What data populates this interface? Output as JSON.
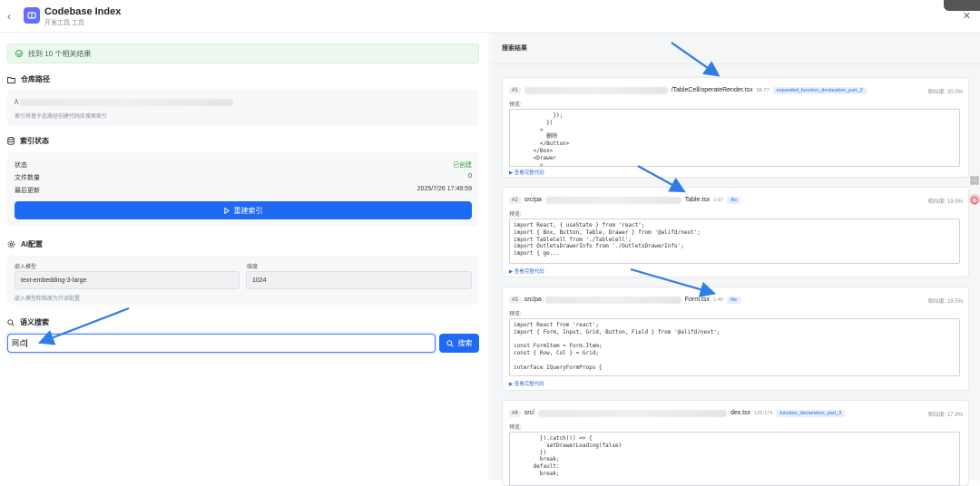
{
  "header": {
    "back_icon": "chevron-left-icon",
    "title": "Codebase Index",
    "subtitle": "开发工具 工具",
    "close_icon": "close-icon"
  },
  "left": {
    "notice": "找到 10 个相关结果",
    "repo": {
      "title": "仓库路径",
      "path_prefix": "/\\",
      "hint": "索引将基于此路径创建代码库搜索索引"
    },
    "index": {
      "title": "索引状态",
      "rows": [
        {
          "label": "状态",
          "value": "已创建"
        },
        {
          "label": "文件数量",
          "value": "0"
        },
        {
          "label": "最后更新",
          "value": "2025/7/26 17:49:59"
        }
      ],
      "rebuild_label": "重建索引"
    },
    "ai": {
      "title": "AI配置",
      "model_label": "嵌入模型",
      "model_value": "text-embedding-3-large",
      "dim_label": "维度",
      "dim_value": "1024",
      "hint": "嵌入模型和维度为只读配置"
    },
    "search": {
      "title": "语义搜索",
      "value": "网点",
      "button_label": "搜索"
    }
  },
  "right": {
    "title": "搜索结果",
    "preview_label": "预览:",
    "view_more": "▶ 查看完整代码",
    "results": [
      {
        "num": "#1",
        "path_start": "",
        "path_end": "/TableCell/operateRender.tsx",
        "lines": "58-77",
        "tag": "expanded_function_declaration_part_2",
        "similarity": "相似度: 20.0%",
        "code": "            });\n          })\n        >\n          删除\n        </Button>\n      </Box>\n      <Drawer\n        v"
      },
      {
        "num": "#2",
        "path_start": "src/pa",
        "path_end": "Table.tsx",
        "lines": "1-67",
        "tag": "file",
        "similarity": "相似度: 19.9%",
        "code": "import React, { useState } from 'react';\nimport { Box, Button, Table, Drawer } from '@alifd/next';\nimport TableCell from './TableCell';\nimport OutletsDrawerInfo from './OutletsDrawerInfo';\nimport { ge..."
      },
      {
        "num": "#3",
        "path_start": "src/pa",
        "path_end": "Form.tsx",
        "lines": "1-40",
        "tag": "file",
        "similarity": "相似度: 19.5%",
        "code": "import React from 'react';\nimport { Form, Input, Grid, Button, Field } from '@alifd/next';\n\nconst FormItem = Form.Item;\nconst { Row, Col } = Grid;\n\ninterface IQueryFormProps {"
      },
      {
        "num": "#4",
        "path_start": "src/",
        "path_end": "dex.tsx",
        "lines": "125-174",
        "tag": "function_declaration_part_3",
        "similarity": "相似度: 17.9%",
        "code": "        }).catch(() => {\n          setDrawerLoading(false)\n        })\n        break;\n      default:\n        break;"
      }
    ]
  }
}
